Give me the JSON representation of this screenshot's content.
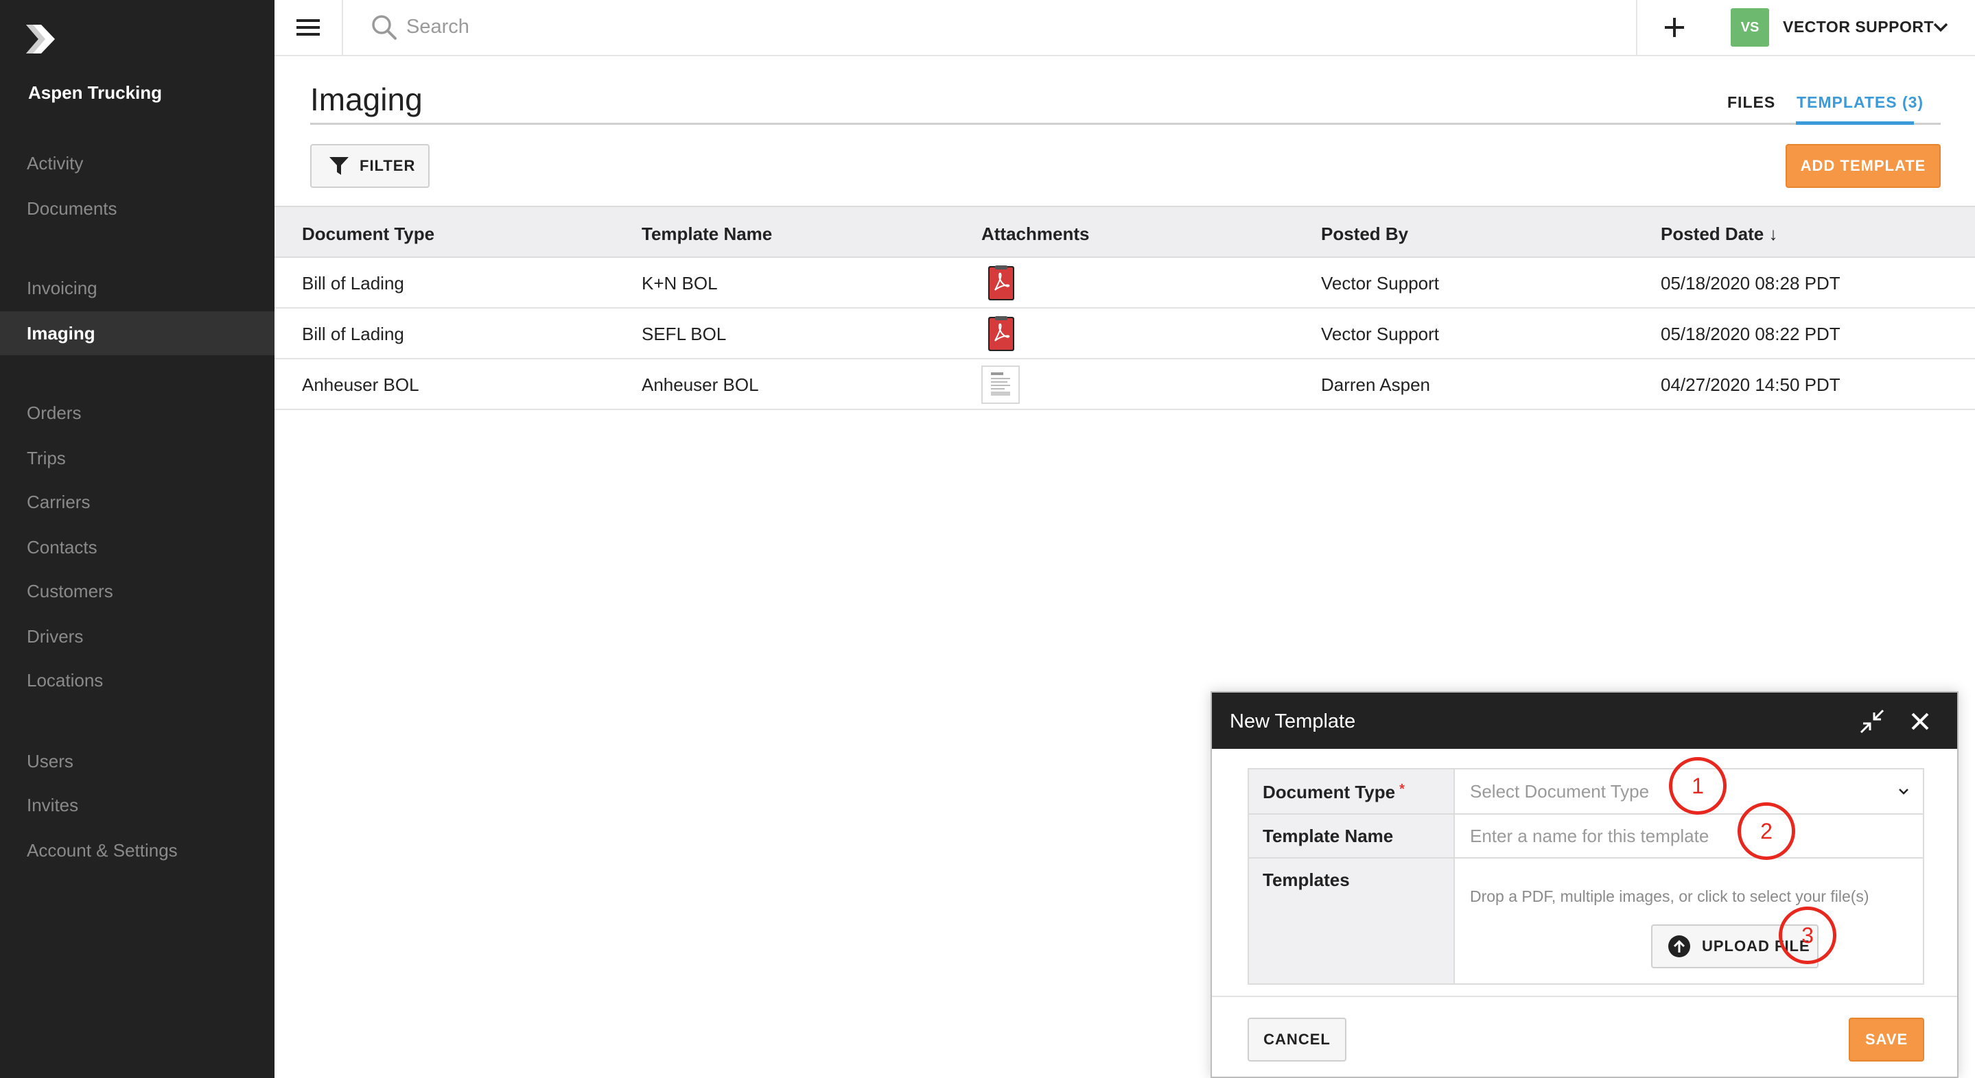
{
  "sidebar": {
    "company": "Aspen Trucking",
    "items": [
      {
        "label": "Activity"
      },
      {
        "label": "Documents"
      },
      {
        "label": "Invoicing"
      },
      {
        "label": "Imaging"
      },
      {
        "label": "Orders"
      },
      {
        "label": "Trips"
      },
      {
        "label": "Carriers"
      },
      {
        "label": "Contacts"
      },
      {
        "label": "Customers"
      },
      {
        "label": "Drivers"
      },
      {
        "label": "Locations"
      },
      {
        "label": "Users"
      },
      {
        "label": "Invites"
      },
      {
        "label": "Account & Settings"
      }
    ],
    "active": "Imaging"
  },
  "topbar": {
    "search": {
      "placeholder": "Search",
      "value": ""
    },
    "user": {
      "initials": "VS",
      "name": "VECTOR SUPPORT"
    }
  },
  "page": {
    "title": "Imaging",
    "tabs": [
      {
        "label": "FILES"
      },
      {
        "label": "TEMPLATES (3)"
      }
    ],
    "active_tab": "TEMPLATES (3)",
    "filter_label": "FILTER",
    "add_label": "ADD TEMPLATE"
  },
  "table": {
    "headers": [
      "Document Type",
      "Template Name",
      "Attachments",
      "Posted By",
      "Posted Date ↓"
    ],
    "rows": [
      {
        "document_type": "Bill of Lading",
        "template_name": "K+N BOL",
        "attachment": "pdf-icon",
        "posted_by": "Vector Support",
        "posted_date": "05/18/2020 08:28 PDT"
      },
      {
        "document_type": "Bill of Lading",
        "template_name": "SEFL BOL",
        "attachment": "pdf-icon",
        "posted_by": "Vector Support",
        "posted_date": "05/18/2020 08:22 PDT"
      },
      {
        "document_type": "Anheuser BOL",
        "template_name": "Anheuser BOL",
        "attachment": "image-thumbnail",
        "posted_by": "Darren Aspen",
        "posted_date": "04/27/2020 14:50 PDT"
      }
    ]
  },
  "modal": {
    "title": "New Template",
    "fields": {
      "document_type": {
        "label": "Document Type",
        "required_mark": "*",
        "placeholder": "Select Document Type"
      },
      "template_name": {
        "label": "Template Name",
        "placeholder": "Enter a name for this template"
      },
      "templates": {
        "label": "Templates",
        "hint": "Drop a PDF, multiple images, or click to select your file(s)",
        "upload_label": "UPLOAD FILE"
      }
    },
    "cancel_label": "CANCEL",
    "save_label": "SAVE",
    "annotations": [
      "1",
      "2",
      "3"
    ]
  },
  "colors": {
    "sidebar_bg": "#222222",
    "accent_orange": "#f59745",
    "tab_blue": "#3b9ad9",
    "avatar_green": "#6cb96f",
    "annotation_red": "#e8271e"
  }
}
